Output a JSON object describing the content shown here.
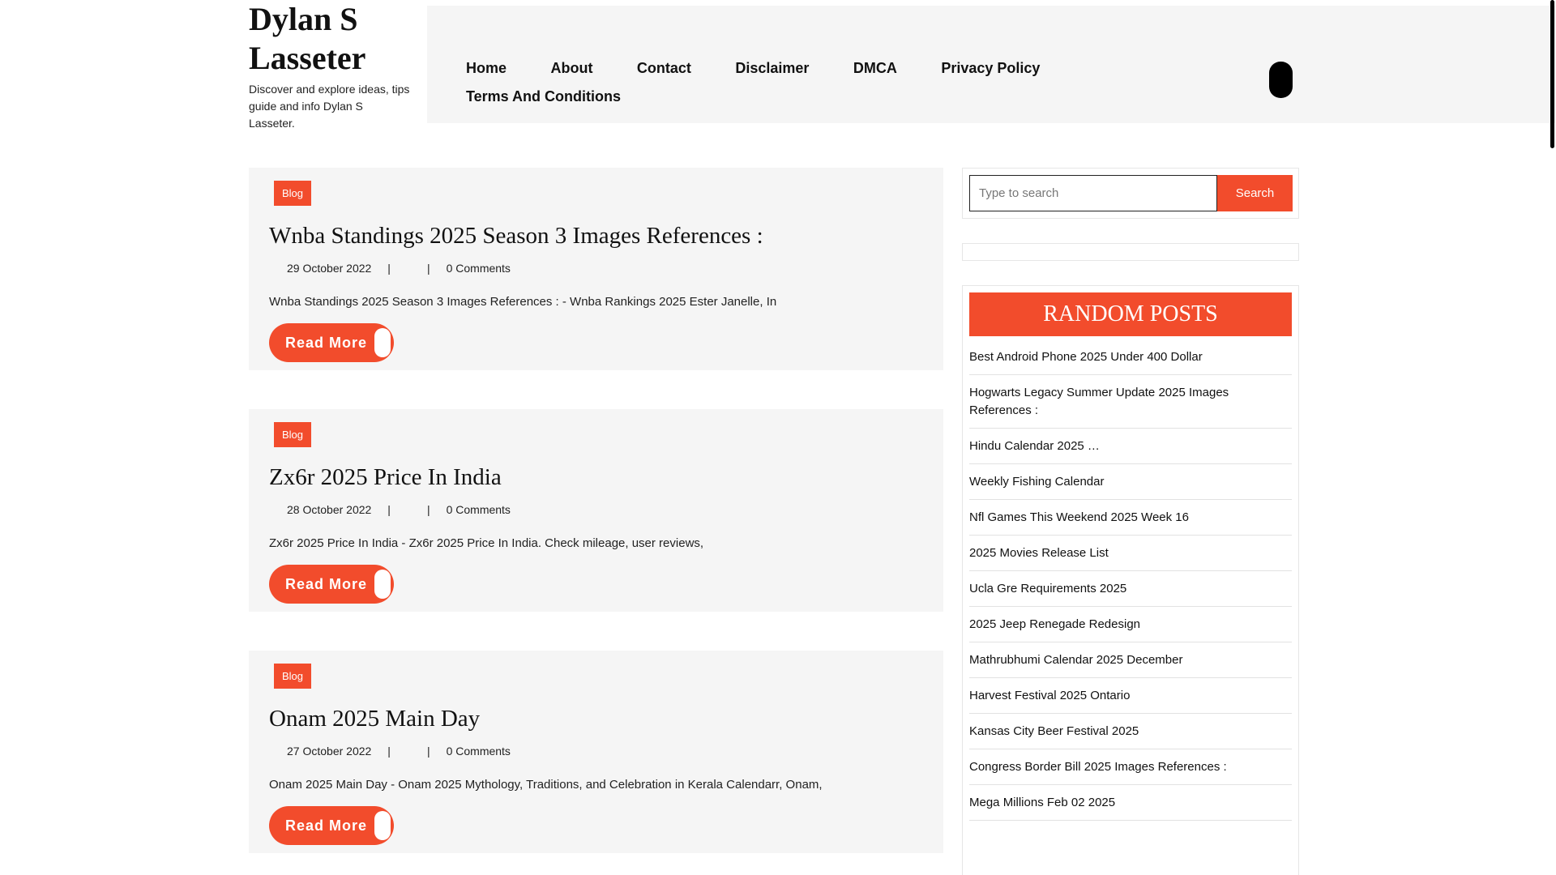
{
  "site": {
    "title": "Dylan S Lasseter",
    "tagline": "Discover and explore ideas, tips guide and info Dylan S Lasseter."
  },
  "nav": {
    "items": [
      "Home",
      "About",
      "Contact",
      "Disclaimer",
      "DMCA",
      "Privacy Policy",
      "Terms And Conditions"
    ]
  },
  "posts": [
    {
      "category": "Blog",
      "title": "Wnba Standings 2025 Season 3 Images References :",
      "date": "29 October 2022",
      "comments": "0 Comments",
      "excerpt": "Wnba Standings 2025 Season 3 Images References : - Wnba Rankings 2025 Ester Janelle, In",
      "read_more": "Read More"
    },
    {
      "category": "Blog",
      "title": "Zx6r 2025 Price In India",
      "date": "28 October 2022",
      "comments": "0 Comments",
      "excerpt": "Zx6r 2025 Price In India - Zx6r 2025 Price In India. Check mileage, user reviews,",
      "read_more": "Read More"
    },
    {
      "category": "Blog",
      "title": "Onam 2025 Main Day",
      "date": "27 October 2022",
      "comments": "0 Comments",
      "excerpt": "Onam 2025 Main Day - Onam 2025 Mythology, Traditions, and Celebration in Kerala Calendarr, Onam,",
      "read_more": "Read More"
    }
  ],
  "search": {
    "placeholder": "Type to search",
    "button": "Search"
  },
  "random_posts": {
    "heading": "RANDOM POSTS",
    "items": [
      "Best Android Phone 2025 Under 400 Dollar",
      "Hogwarts Legacy Summer Update 2025 Images References :",
      "Hindu Calendar 2025 …",
      "Weekly Fishing Calendar",
      "Nfl Games This Weekend 2025 Week 16",
      "2025 Movies Release List",
      "Ucla Gre Requirements 2025",
      "2025 Jeep Renegade Redesign",
      "Mathrubhumi Calendar 2025 December",
      "Harvest Festival 2025 Ontario",
      "Kansas City Beer Festival 2025",
      "Congress Border Bill 2025 Images References :",
      "Mega Millions Feb 02 2025"
    ]
  },
  "colors": {
    "accent": "#f24c2c",
    "panel": "#f5f5f5",
    "text": "#111111"
  }
}
